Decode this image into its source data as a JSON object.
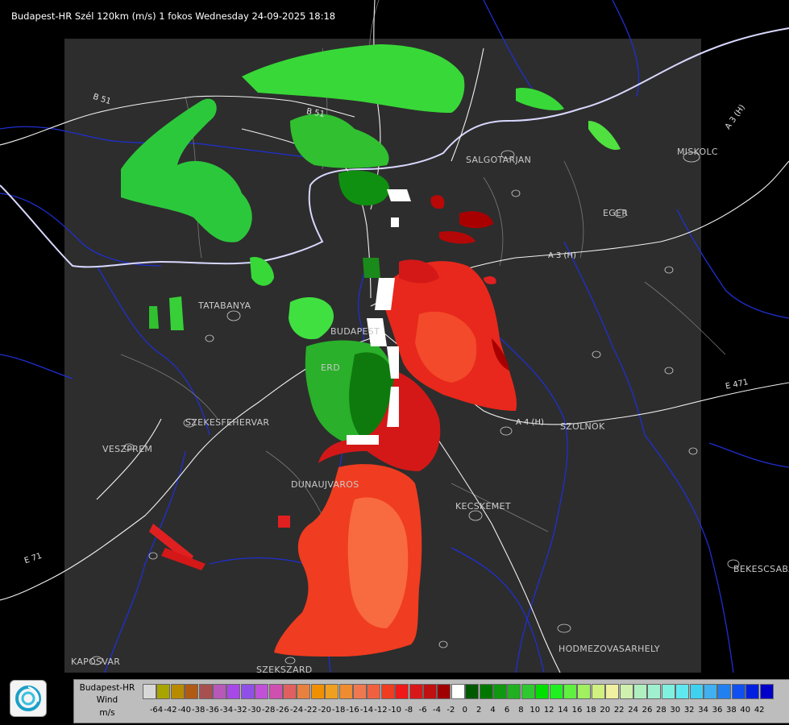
{
  "header": {
    "title": "Budapest-HR Szél 120km (m/s) 1 fokos Wednesday 24-09-2025 18:18"
  },
  "map": {
    "cities": [
      {
        "name": "SALGOTARJAN",
        "key": "salgotarjan"
      },
      {
        "name": "EGER",
        "key": "eger"
      },
      {
        "name": "MISKOLC",
        "key": "miskolc"
      },
      {
        "name": "TATABANYA",
        "key": "tatabanya"
      },
      {
        "name": "BUDAPEST",
        "key": "budapest"
      },
      {
        "name": "ERD",
        "key": "erd"
      },
      {
        "name": "SZEKESFEHERVAR",
        "key": "szekesfehervar"
      },
      {
        "name": "VESZPREM",
        "key": "veszprem"
      },
      {
        "name": "SZOLNOK",
        "key": "szolnok"
      },
      {
        "name": "DUNAUJVAROS",
        "key": "dunaujvaros"
      },
      {
        "name": "KECSKEMET",
        "key": "kecskemet"
      },
      {
        "name": "BEKESCSABA",
        "key": "bekescsaba"
      },
      {
        "name": "HODMEZOVASARHELY",
        "key": "hodmezovasarhely"
      },
      {
        "name": "KAPOSVAR",
        "key": "kaposvar"
      },
      {
        "name": "SZEKSZARD",
        "key": "szekszard"
      }
    ],
    "roads": [
      {
        "name": "B 51",
        "key": "b51a"
      },
      {
        "name": "B 51",
        "key": "b51b"
      },
      {
        "name": "A 3 (H)",
        "key": "a3"
      },
      {
        "name": "A 3 (H)",
        "key": "a3ne"
      },
      {
        "name": "A 4 (H)",
        "key": "a4"
      },
      {
        "name": "E 471",
        "key": "e471"
      },
      {
        "name": "E 71",
        "key": "e71"
      }
    ]
  },
  "legend": {
    "title_lines": [
      "Budapest-HR",
      "Wind",
      "m/s"
    ],
    "ticks": [
      "-64",
      "-42",
      "-40",
      "-38",
      "-36",
      "-34",
      "-32",
      "-30",
      "-28",
      "-26",
      "-24",
      "-22",
      "-20",
      "-18",
      "-16",
      "-14",
      "-12",
      "-10",
      "-8",
      "-6",
      "-4",
      "-2",
      "0",
      "2",
      "4",
      "6",
      "8",
      "10",
      "12",
      "14",
      "16",
      "18",
      "20",
      "22",
      "24",
      "26",
      "28",
      "30",
      "32",
      "34",
      "36",
      "38",
      "40",
      "42"
    ],
    "colors": [
      "#d8d8d8",
      "#a8a400",
      "#b88a00",
      "#b05a14",
      "#a85050",
      "#b858b8",
      "#a848e8",
      "#9050e8",
      "#c050d8",
      "#d050b0",
      "#e06060",
      "#e88040",
      "#f09000",
      "#f0a020",
      "#f08c30",
      "#f07850",
      "#f06040",
      "#f03c20",
      "#f01818",
      "#d81818",
      "#c01010",
      "#a00000",
      "#ffffff",
      "#005800",
      "#007800",
      "#109810",
      "#20b020",
      "#30c830",
      "#00e000",
      "#20f020",
      "#60f040",
      "#a0f060",
      "#d0f080",
      "#f0f0a0",
      "#d0f0b0",
      "#b0f0c0",
      "#a0f0d0",
      "#80f0e0",
      "#60e8f0",
      "#40d0f0",
      "#40b0f0",
      "#2080f0",
      "#1050f0",
      "#0020e0",
      "#0000c8"
    ]
  },
  "logo": {
    "name": "omsz-logo"
  }
}
